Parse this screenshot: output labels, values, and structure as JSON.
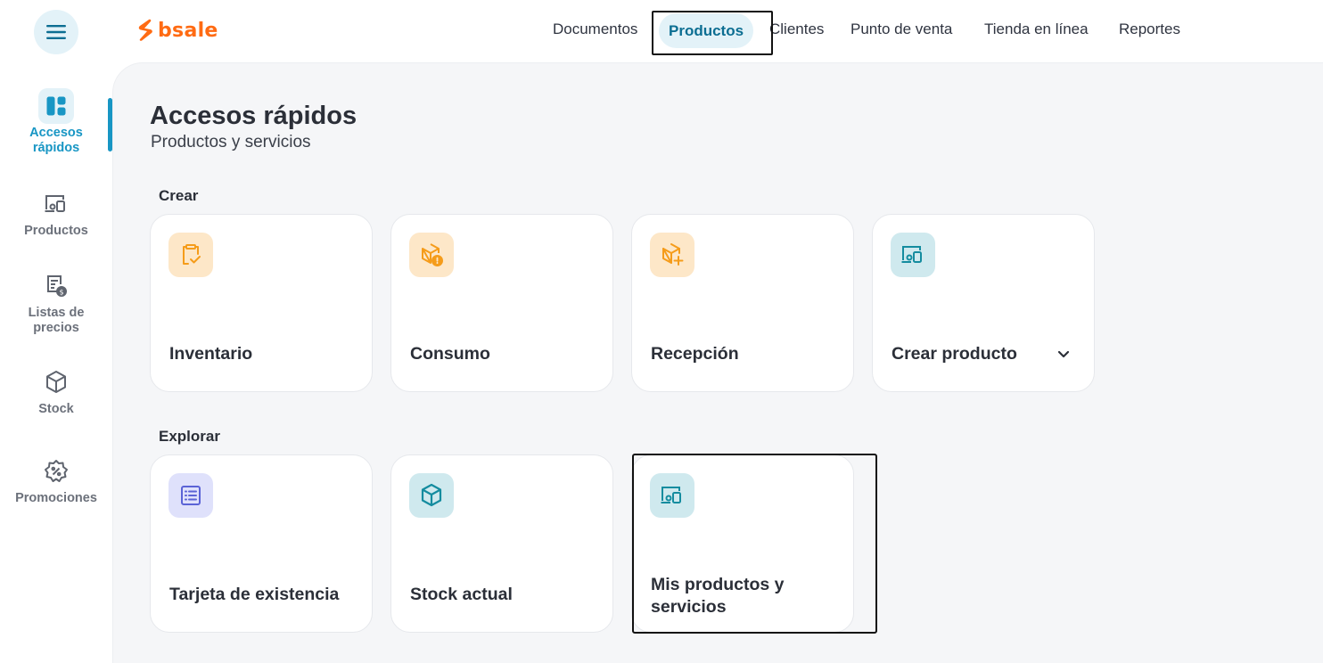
{
  "brand": {
    "name": "bsale",
    "color": "#ff6b13"
  },
  "accent_color": "#1896c4",
  "topnav": {
    "items": [
      {
        "label": "Documentos"
      },
      {
        "label": "Productos"
      },
      {
        "label": "Clientes"
      },
      {
        "label": "Punto de venta"
      },
      {
        "label": "Tienda en línea"
      },
      {
        "label": "Reportes"
      }
    ],
    "active": "Productos"
  },
  "sidebar": {
    "items": [
      {
        "label": "Accesos rápidos",
        "icon": "dashboard-icon",
        "active": true
      },
      {
        "label": "Productos",
        "icon": "products-icon"
      },
      {
        "label": "Listas de precios",
        "icon": "price-list-icon"
      },
      {
        "label": "Stock",
        "icon": "cube-icon"
      },
      {
        "label": "Promociones",
        "icon": "discount-badge-icon"
      }
    ]
  },
  "page": {
    "title": "Accesos rápidos",
    "subtitle": "Productos y servicios"
  },
  "sections": {
    "create": {
      "title": "Crear",
      "cards": [
        {
          "label": "Inventario",
          "icon": "clipboard-check-icon",
          "color": "#f59c1a"
        },
        {
          "label": "Consumo",
          "icon": "box-alert-icon",
          "color": "#f59c1a"
        },
        {
          "label": "Recepción",
          "icon": "box-plus-icon",
          "color": "#f59c1a"
        },
        {
          "label": "Crear producto",
          "icon": "products-icon",
          "color": "#148c9f",
          "has_dropdown": true
        }
      ]
    },
    "explore": {
      "title": "Explorar",
      "cards": [
        {
          "label": "Tarjeta de existencia",
          "icon": "list-card-icon",
          "color": "#5b63d6"
        },
        {
          "label": "Stock actual",
          "icon": "cube-icon",
          "color": "#148c9f"
        },
        {
          "label": "Mis productos y servicios",
          "icon": "products-icon",
          "color": "#148c9f"
        }
      ]
    }
  }
}
